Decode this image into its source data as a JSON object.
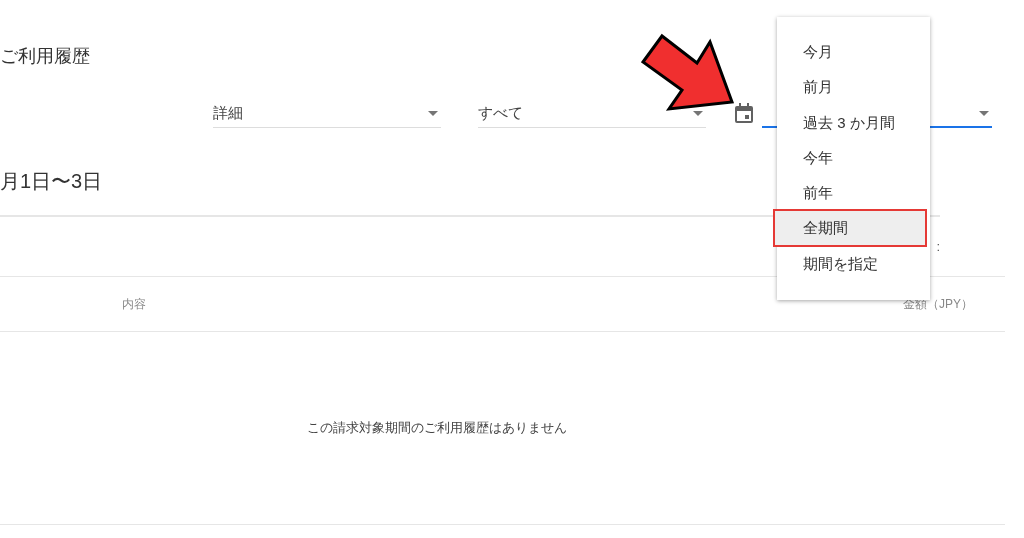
{
  "page": {
    "title": "ご利用履歴"
  },
  "filters": [
    {
      "kind": "select",
      "value": "詳細",
      "focused": false
    },
    {
      "kind": "select",
      "value": "すべて",
      "focused": false
    },
    {
      "kind": "date-select",
      "focused": true
    }
  ],
  "period": {
    "label": "月1日〜3日"
  },
  "summary": {
    "column_3": ":"
  },
  "table": {
    "columns": [
      "内容",
      "金額（JPY）"
    ],
    "empty_message": "この請求対象期間のご利用履歴はありません"
  },
  "menu": {
    "items": [
      {
        "label": "今月",
        "selected": false,
        "highlighted": false
      },
      {
        "label": "前月",
        "selected": false,
        "highlighted": false
      },
      {
        "label": "過去 3 か月間",
        "selected": false,
        "highlighted": false
      },
      {
        "label": "今年",
        "selected": false,
        "highlighted": false
      },
      {
        "label": "前年",
        "selected": false,
        "highlighted": false
      },
      {
        "label": "全期間",
        "selected": true,
        "highlighted": true
      },
      {
        "label": "期間を指定",
        "selected": false,
        "highlighted": false
      }
    ]
  },
  "annotations": [
    {
      "kind": "arrow"
    }
  ]
}
